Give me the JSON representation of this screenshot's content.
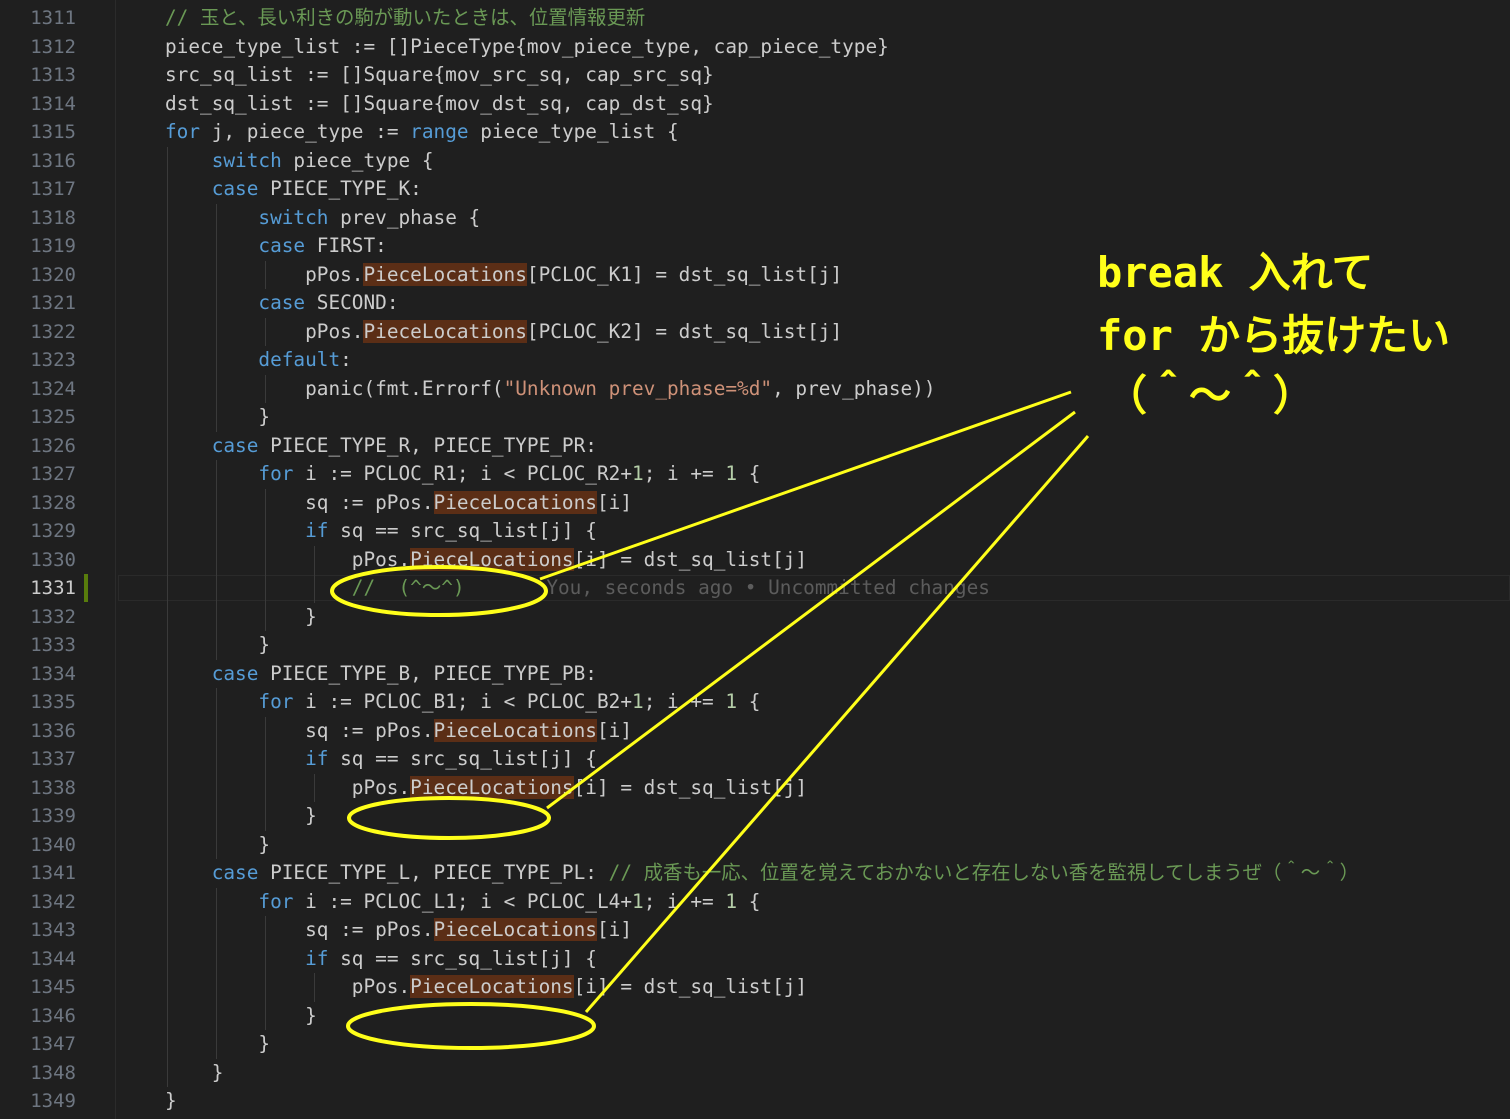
{
  "editor": {
    "current_line": "1331",
    "lines": [
      {
        "num": "1311",
        "segs": [
          [
            "// 玉と、長い利きの駒が動いたときは、位置情報更新",
            "cm"
          ]
        ]
      },
      {
        "num": "1312",
        "segs": [
          [
            "piece_type_list := []PieceType{mov_piece_type, cap_piece_type}",
            ""
          ]
        ]
      },
      {
        "num": "1313",
        "segs": [
          [
            "src_sq_list := []Square{mov_src_sq, cap_src_sq}",
            ""
          ]
        ]
      },
      {
        "num": "1314",
        "segs": [
          [
            "dst_sq_list := []Square{mov_dst_sq, cap_dst_sq}",
            ""
          ]
        ]
      },
      {
        "num": "1315",
        "segs": [
          [
            "for",
            "kw"
          ],
          [
            " j, piece_type := ",
            ""
          ],
          [
            "range",
            "kw"
          ],
          [
            " piece_type_list {",
            ""
          ]
        ]
      },
      {
        "num": "1316",
        "segs": [
          [
            "    ",
            ""
          ],
          [
            "switch",
            "kw"
          ],
          [
            " piece_type {",
            ""
          ]
        ]
      },
      {
        "num": "1317",
        "segs": [
          [
            "    ",
            ""
          ],
          [
            "case",
            "kw"
          ],
          [
            " PIECE_TYPE_K:",
            ""
          ]
        ]
      },
      {
        "num": "1318",
        "segs": [
          [
            "        ",
            ""
          ],
          [
            "switch",
            "kw"
          ],
          [
            " prev_phase {",
            ""
          ]
        ]
      },
      {
        "num": "1319",
        "segs": [
          [
            "        ",
            ""
          ],
          [
            "case",
            "kw"
          ],
          [
            " FIRST:",
            ""
          ]
        ]
      },
      {
        "num": "1320",
        "segs": [
          [
            "            pPos.",
            ""
          ],
          [
            "PieceLocations",
            "fl"
          ],
          [
            "[PCLOC_K1] = dst_sq_list[j]",
            ""
          ]
        ]
      },
      {
        "num": "1321",
        "segs": [
          [
            "        ",
            ""
          ],
          [
            "case",
            "kw"
          ],
          [
            " SECOND:",
            ""
          ]
        ]
      },
      {
        "num": "1322",
        "segs": [
          [
            "            pPos.",
            ""
          ],
          [
            "PieceLocations",
            "fl"
          ],
          [
            "[PCLOC_K2] = dst_sq_list[j]",
            ""
          ]
        ]
      },
      {
        "num": "1323",
        "segs": [
          [
            "        ",
            ""
          ],
          [
            "default",
            "kw"
          ],
          [
            ":",
            ""
          ]
        ]
      },
      {
        "num": "1324",
        "segs": [
          [
            "            panic(fmt.Errorf(",
            ""
          ],
          [
            "\"Unknown prev_phase=%d\"",
            "st"
          ],
          [
            ", prev_phase))",
            ""
          ]
        ]
      },
      {
        "num": "1325",
        "segs": [
          [
            "        }",
            ""
          ]
        ]
      },
      {
        "num": "1326",
        "segs": [
          [
            "    ",
            ""
          ],
          [
            "case",
            "kw"
          ],
          [
            " PIECE_TYPE_R, PIECE_TYPE_PR:",
            ""
          ]
        ]
      },
      {
        "num": "1327",
        "segs": [
          [
            "        ",
            ""
          ],
          [
            "for",
            "kw"
          ],
          [
            " i := PCLOC_R1; i < PCLOC_R2+",
            ""
          ],
          [
            "1",
            "nm"
          ],
          [
            "; i += ",
            ""
          ],
          [
            "1",
            "nm"
          ],
          [
            " {",
            ""
          ]
        ]
      },
      {
        "num": "1328",
        "segs": [
          [
            "            sq := pPos.",
            ""
          ],
          [
            "PieceLocations",
            "fl"
          ],
          [
            "[i]",
            ""
          ]
        ]
      },
      {
        "num": "1329",
        "segs": [
          [
            "            ",
            ""
          ],
          [
            "if",
            "kw"
          ],
          [
            " sq == src_sq_list[j] {",
            ""
          ]
        ]
      },
      {
        "num": "1330",
        "segs": [
          [
            "                pPos.",
            ""
          ],
          [
            "PieceLocations",
            "fl"
          ],
          [
            "[i] = dst_sq_list[j]",
            ""
          ]
        ]
      },
      {
        "num": "1331",
        "segs": [
          [
            "                ",
            ""
          ],
          [
            "//  (^～^)",
            "cm"
          ],
          [
            "       You, seconds ago • Uncommitted changes",
            "blame"
          ]
        ]
      },
      {
        "num": "1332",
        "segs": [
          [
            "            }",
            ""
          ]
        ]
      },
      {
        "num": "1333",
        "segs": [
          [
            "        }",
            ""
          ]
        ]
      },
      {
        "num": "1334",
        "segs": [
          [
            "    ",
            ""
          ],
          [
            "case",
            "kw"
          ],
          [
            " PIECE_TYPE_B, PIECE_TYPE_PB:",
            ""
          ]
        ]
      },
      {
        "num": "1335",
        "segs": [
          [
            "        ",
            ""
          ],
          [
            "for",
            "kw"
          ],
          [
            " i := PCLOC_B1; i < PCLOC_B2+",
            ""
          ],
          [
            "1",
            "nm"
          ],
          [
            "; i += ",
            ""
          ],
          [
            "1",
            "nm"
          ],
          [
            " {",
            ""
          ]
        ]
      },
      {
        "num": "1336",
        "segs": [
          [
            "            sq := pPos.",
            ""
          ],
          [
            "PieceLocations",
            "fl"
          ],
          [
            "[i]",
            ""
          ]
        ]
      },
      {
        "num": "1337",
        "segs": [
          [
            "            ",
            ""
          ],
          [
            "if",
            "kw"
          ],
          [
            " sq == src_sq_list[j] {",
            ""
          ]
        ]
      },
      {
        "num": "1338",
        "segs": [
          [
            "                pPos.",
            ""
          ],
          [
            "PieceLocations",
            "fl"
          ],
          [
            "[i] = dst_sq_list[j]",
            ""
          ]
        ]
      },
      {
        "num": "1339",
        "segs": [
          [
            "            }",
            ""
          ]
        ]
      },
      {
        "num": "1340",
        "segs": [
          [
            "        }",
            ""
          ]
        ]
      },
      {
        "num": "1341",
        "segs": [
          [
            "    ",
            ""
          ],
          [
            "case",
            "kw"
          ],
          [
            " PIECE_TYPE_L, PIECE_TYPE_PL: ",
            ""
          ],
          [
            "// 成香も一応、位置を覚えておかないと存在しない香を監視してしまうぜ（＾～＾）",
            "cm"
          ]
        ]
      },
      {
        "num": "1342",
        "segs": [
          [
            "        ",
            ""
          ],
          [
            "for",
            "kw"
          ],
          [
            " i := PCLOC_L1; i < PCLOC_L4+",
            ""
          ],
          [
            "1",
            "nm"
          ],
          [
            "; i += ",
            ""
          ],
          [
            "1",
            "nm"
          ],
          [
            " {",
            ""
          ]
        ]
      },
      {
        "num": "1343",
        "segs": [
          [
            "            sq := pPos.",
            ""
          ],
          [
            "PieceLocations",
            "fl"
          ],
          [
            "[i]",
            ""
          ]
        ]
      },
      {
        "num": "1344",
        "segs": [
          [
            "            ",
            ""
          ],
          [
            "if",
            "kw"
          ],
          [
            " sq == src_sq_list[j] {",
            ""
          ]
        ]
      },
      {
        "num": "1345",
        "segs": [
          [
            "                pPos.",
            ""
          ],
          [
            "PieceLocations",
            "fl"
          ],
          [
            "[i] = dst_sq_list[j]",
            ""
          ]
        ]
      },
      {
        "num": "1346",
        "segs": [
          [
            "            }",
            ""
          ]
        ]
      },
      {
        "num": "1347",
        "segs": [
          [
            "        }",
            ""
          ]
        ]
      },
      {
        "num": "1348",
        "segs": [
          [
            "    }",
            ""
          ]
        ]
      },
      {
        "num": "1349",
        "segs": [
          [
            "}",
            ""
          ]
        ]
      }
    ]
  },
  "annotation": {
    "line1": "break 入れて",
    "line2": "for から抜けたい",
    "line3": "（＾～＾）",
    "color": "#ffff1a"
  }
}
